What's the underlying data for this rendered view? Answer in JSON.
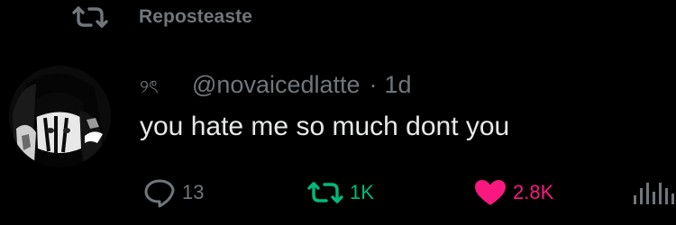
{
  "repost_header": {
    "label": "Reposteaste"
  },
  "post": {
    "display_name_emoji": "୨ৎ",
    "handle": "@novaicedlatte",
    "separator": "·",
    "time_ago": "1d",
    "text": "you hate me so much dont you"
  },
  "actions": {
    "reply_count": "13",
    "repost_count": "1K",
    "like_count": "2.8K"
  },
  "colors": {
    "background": "#000000",
    "muted": "#71767b",
    "text": "#e7e9ea",
    "repost_active": "#00ba7c",
    "like_active": "#f91880"
  },
  "icons": {
    "repost_header": "repost-icon",
    "reply": "reply-icon",
    "repost": "repost-icon",
    "like": "heart-icon",
    "views": "views-icon"
  }
}
